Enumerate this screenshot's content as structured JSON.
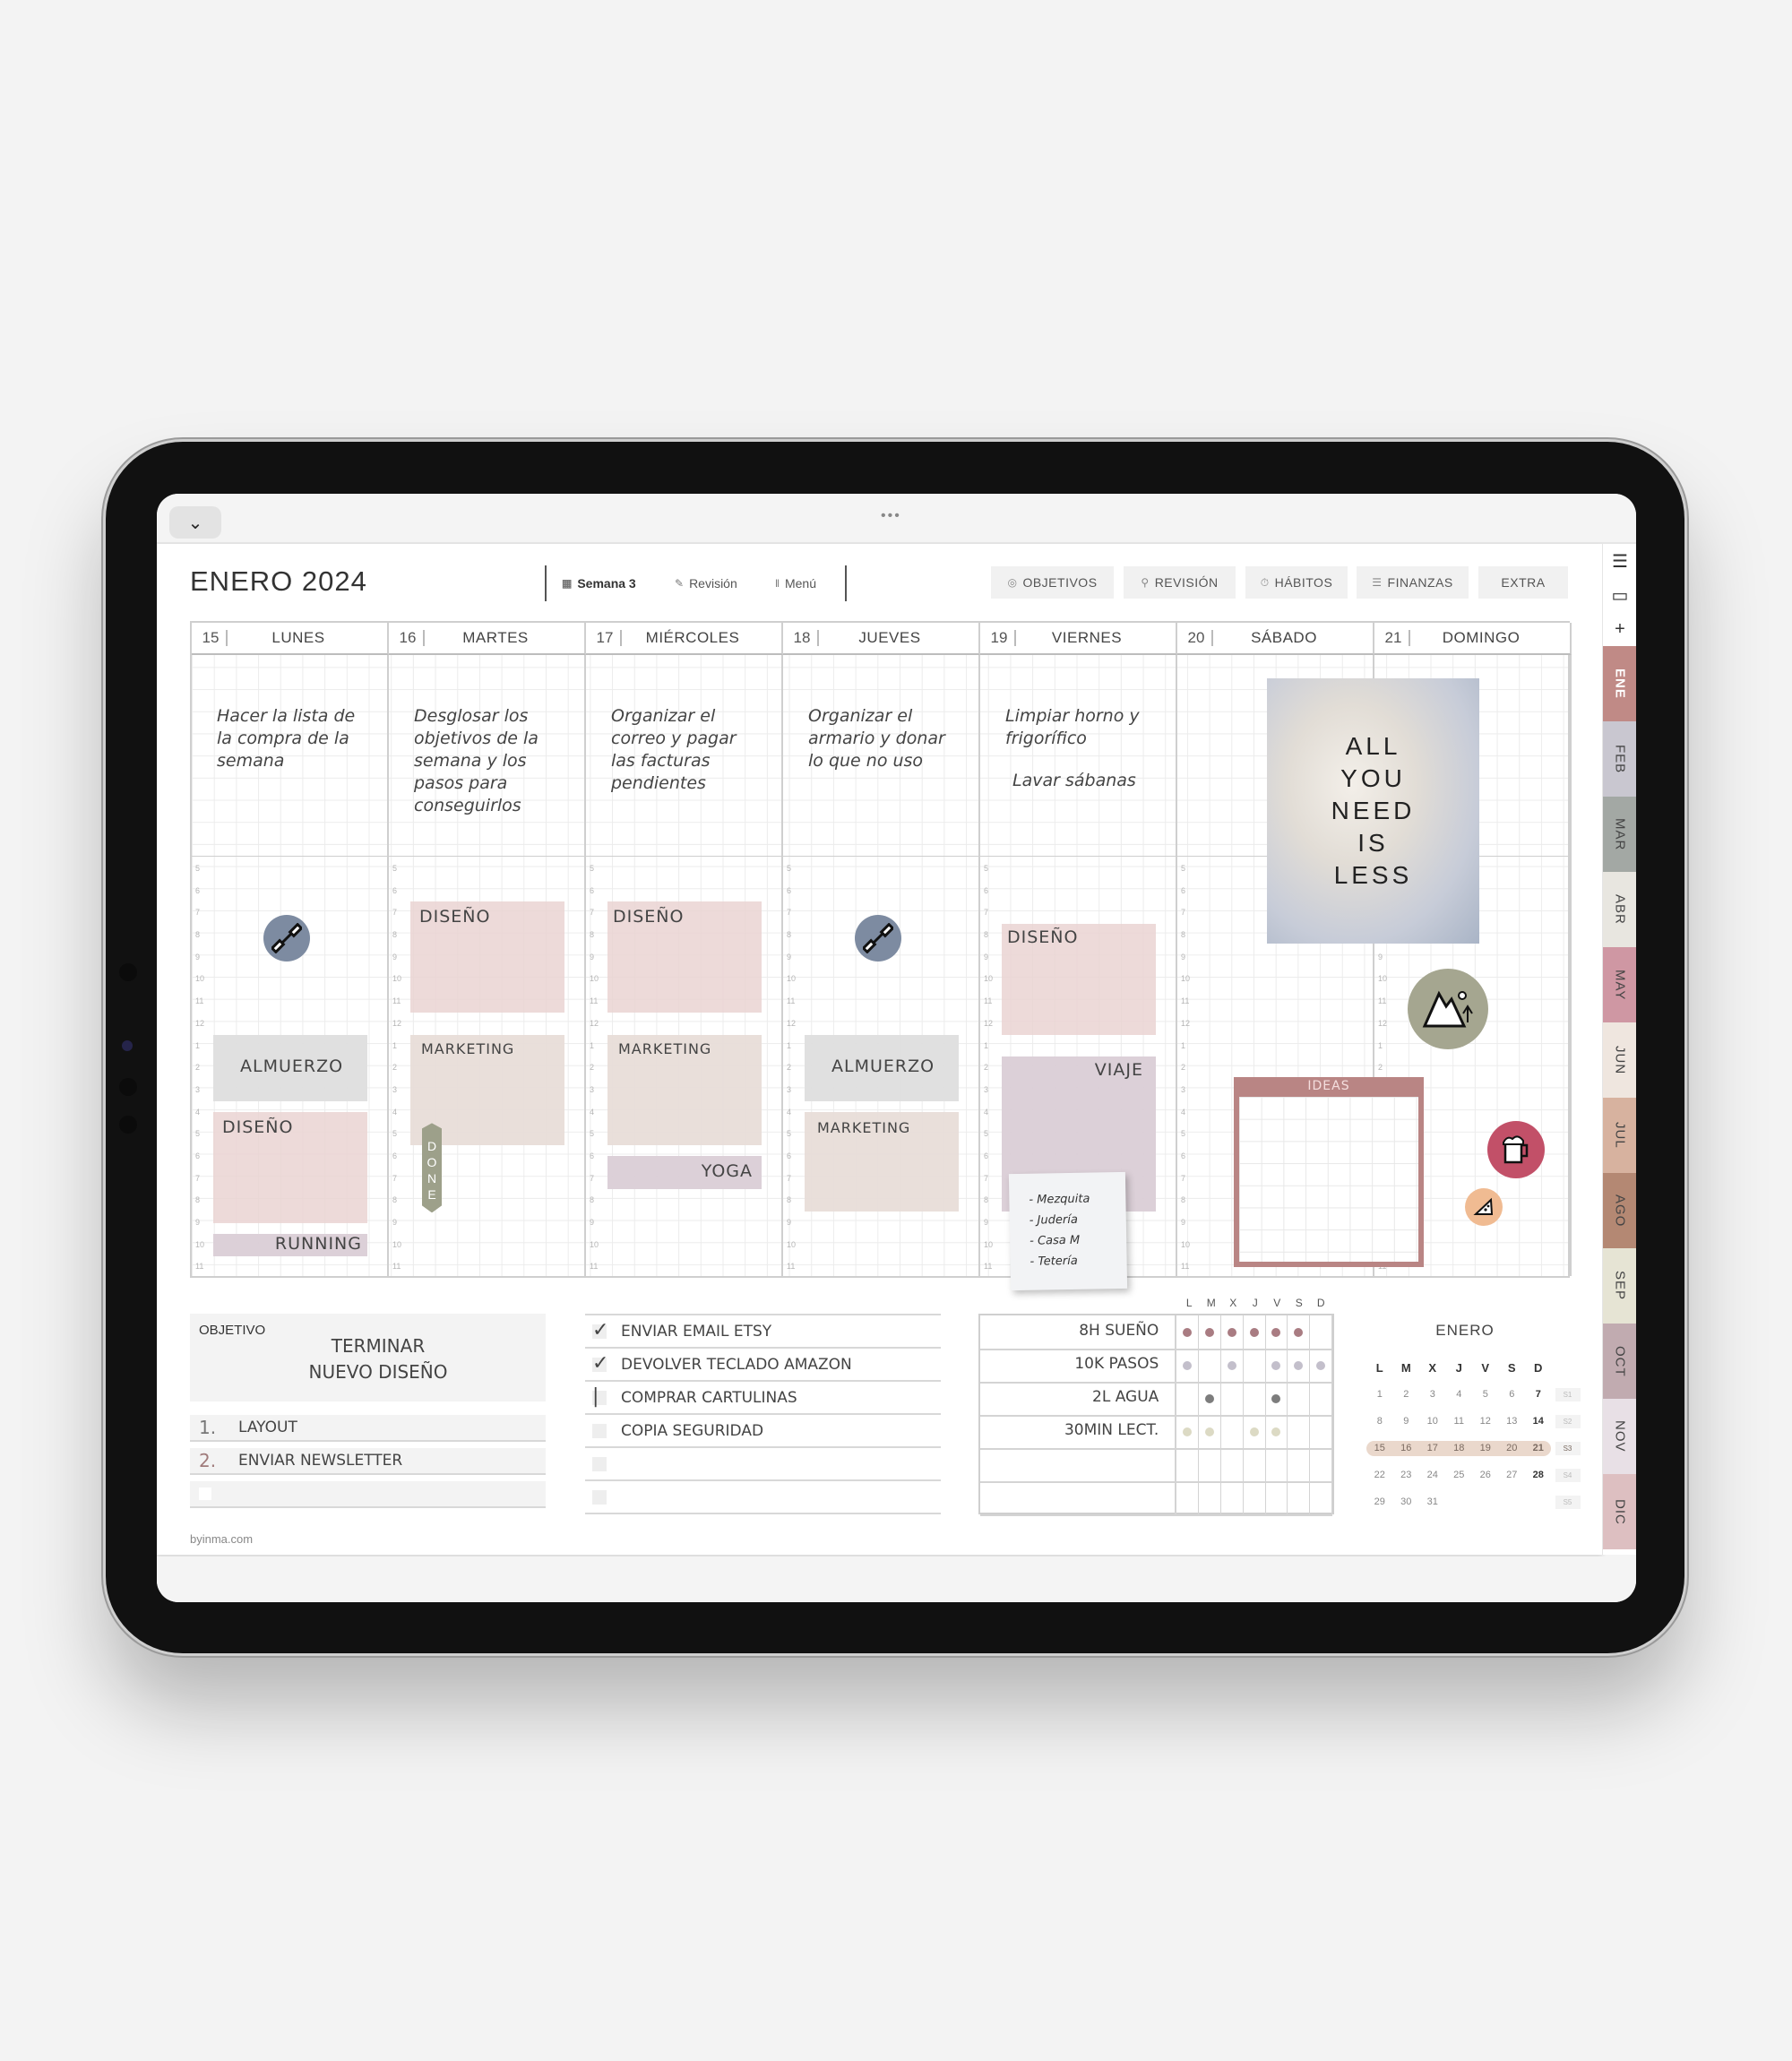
{
  "toolbar": {
    "collapse_icon": "chevron-down",
    "handle": "•••"
  },
  "header": {
    "title": "ENERO  2024",
    "nav": [
      {
        "label": "Semana 3",
        "icon": "calendar-icon",
        "bold": true
      },
      {
        "label": "Revisión",
        "icon": "notepad-icon"
      },
      {
        "label": "Menú",
        "icon": "cutlery-icon"
      }
    ],
    "sections": [
      {
        "label": "OBJETIVOS",
        "icon": "target-icon"
      },
      {
        "label": "REVISIÓN",
        "icon": "magnifier-icon"
      },
      {
        "label": "HÁBITOS",
        "icon": "stopwatch-icon"
      },
      {
        "label": "FINANZAS",
        "icon": "coins-icon"
      },
      {
        "label": "EXTRA",
        "icon": ""
      }
    ]
  },
  "week": {
    "hours": [
      "5",
      "6",
      "7",
      "8",
      "9",
      "10",
      "11",
      "12",
      "1",
      "2",
      "3",
      "4",
      "5",
      "6",
      "7",
      "8",
      "9",
      "10",
      "11"
    ],
    "days": [
      {
        "num": "15",
        "name": "LUNES",
        "note": "Hacer la lista de la compra de la semana"
      },
      {
        "num": "16",
        "name": "MARTES",
        "note": "Desglosar los objetivos de la semana y los pasos para conseguirlos"
      },
      {
        "num": "17",
        "name": "MIÉRCOLES",
        "note": "Organizar el correo y pagar las facturas pendientes"
      },
      {
        "num": "18",
        "name": "JUEVES",
        "note": "Organizar el armario y donar lo que no uso"
      },
      {
        "num": "19",
        "name": "VIERNES",
        "note": "Limpiar horno y frigorífico",
        "note2": "Lavar sábanas"
      },
      {
        "num": "20",
        "name": "SÁBADO",
        "note": ""
      },
      {
        "num": "21",
        "name": "DOMINGO",
        "note": ""
      }
    ],
    "events": {
      "mon_almuerzo": "ALMUERZO",
      "mon_diseno": "DISEÑO",
      "mon_running": "RUNNING",
      "tue_diseno": "DISEÑO",
      "tue_marketing": "MARKETING",
      "tue_done": "DONE",
      "wed_diseno": "DISEÑO",
      "wed_marketing": "MARKETING",
      "wed_yoga": "YOGA",
      "thu_almuerzo": "ALMUERZO",
      "thu_marketing": "MARKETING",
      "fri_diseno": "DISEÑO",
      "fri_viaje": "VIAJE"
    },
    "quote": [
      "ALL",
      "YOU",
      "NEED",
      "IS",
      "LESS"
    ],
    "ideas_label": "IDEAS",
    "sticky": [
      "- Mezquita",
      "- Judería",
      "- Casa M",
      "- Tetería"
    ]
  },
  "goal": {
    "label": "OBJETIVO",
    "text_line1": "TERMINAR",
    "text_line2": "NUEVO DISEÑO",
    "steps": [
      {
        "n": "1.",
        "text": "LAYOUT"
      },
      {
        "n": "2.",
        "text": "ENVIAR NEWSLETTER"
      },
      {
        "n": "",
        "text": ""
      }
    ]
  },
  "todos": [
    {
      "text": "ENVIAR EMAIL ETSY",
      "mark": "✓"
    },
    {
      "text": "DEVOLVER TECLADO AMAZON",
      "mark": "✓"
    },
    {
      "text": "COMPRAR CARTULINAS",
      "mark": "|"
    },
    {
      "text": "COPIA SEGURIDAD",
      "mark": ""
    },
    {
      "text": "",
      "mark": ""
    },
    {
      "text": "",
      "mark": ""
    }
  ],
  "habits": {
    "days": [
      "L",
      "M",
      "X",
      "J",
      "V",
      "S",
      "D"
    ],
    "rows": [
      {
        "name": "8H SUEÑO",
        "color": "#a97c82",
        "done": [
          1,
          1,
          1,
          1,
          1,
          1,
          0
        ]
      },
      {
        "name": "10K PASOS",
        "color": "#c3bfcb",
        "done": [
          1,
          0,
          1,
          0,
          1,
          1,
          1
        ]
      },
      {
        "name": "2L AGUA",
        "color": "#7d7d7d",
        "done": [
          0,
          1,
          0,
          0,
          1,
          0,
          0
        ]
      },
      {
        "name": "30MIN LECT.",
        "color": "#dcdac4",
        "done": [
          1,
          1,
          0,
          1,
          1,
          0,
          0
        ]
      },
      {
        "name": "",
        "color": "",
        "done": [
          0,
          0,
          0,
          0,
          0,
          0,
          0
        ]
      },
      {
        "name": "",
        "color": "",
        "done": [
          0,
          0,
          0,
          0,
          0,
          0,
          0
        ]
      }
    ]
  },
  "mini_calendar": {
    "title": "ENERO",
    "headers": [
      "L",
      "M",
      "X",
      "J",
      "V",
      "S",
      "D"
    ],
    "weeks": [
      {
        "days": [
          "1",
          "2",
          "3",
          "4",
          "5",
          "6",
          "7"
        ],
        "wk": "S1"
      },
      {
        "days": [
          "8",
          "9",
          "10",
          "11",
          "12",
          "13",
          "14"
        ],
        "wk": "S2"
      },
      {
        "days": [
          "15",
          "16",
          "17",
          "18",
          "19",
          "20",
          "21"
        ],
        "wk": "S3",
        "current": true
      },
      {
        "days": [
          "22",
          "23",
          "24",
          "25",
          "26",
          "27",
          "28"
        ],
        "wk": "S4"
      },
      {
        "days": [
          "29",
          "30",
          "31",
          "",
          "",
          "",
          ""
        ],
        "wk": "S5"
      }
    ]
  },
  "footer": "byinma.com",
  "side_tools": [
    "☰",
    "▭",
    "+"
  ],
  "months": [
    {
      "label": "ENE",
      "color": "#c08a86",
      "active": true
    },
    {
      "label": "FEB",
      "color": "#c9c7d0"
    },
    {
      "label": "MAR",
      "color": "#a3a8a4"
    },
    {
      "label": "ABR",
      "color": "#e8e6e0"
    },
    {
      "label": "MAY",
      "color": "#cf97a3"
    },
    {
      "label": "JUN",
      "color": "#efe6df"
    },
    {
      "label": "JUL",
      "color": "#d7b29f"
    },
    {
      "label": "AGO",
      "color": "#b48873"
    },
    {
      "label": "SEP",
      "color": "#e6e4d4"
    },
    {
      "label": "OCT",
      "color": "#c1abb0"
    },
    {
      "label": "NOV",
      "color": "#e8e0e6"
    },
    {
      "label": "DIC",
      "color": "#ddbfc1"
    }
  ]
}
